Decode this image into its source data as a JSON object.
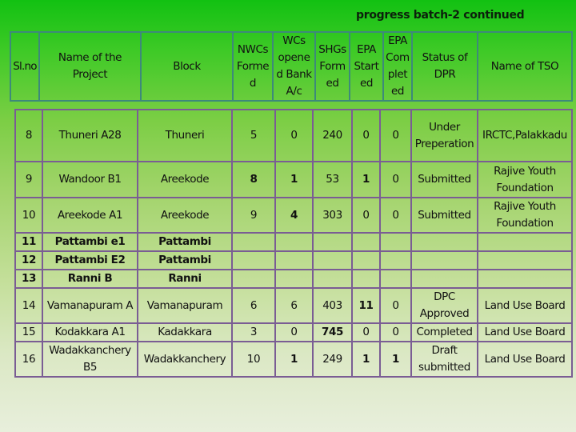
{
  "title": "progress batch-2 continued",
  "columns": [
    "Sl.no",
    "Name of the Project",
    "Block",
    "NWCs Formed",
    "WCs opened Bank A/c",
    "SHGs Formed",
    "EPA Started",
    "EPA Completed",
    "Status of DPR",
    "Name of TSO"
  ],
  "header_display": [
    "Sl.no",
    "Name of the\nProject",
    "Block",
    "NWCs\nForme\nd",
    "WCs\nopene\nd Bank\nA/c",
    "SHGs\nForm\ned",
    "EPA\nStart\ned",
    "EPA\nCom\nplet\ned",
    "Status of\nDPR",
    "Name of TSO"
  ],
  "rows": [
    {
      "slno": "8",
      "project": "Thuneri A28",
      "block": "Thuneri",
      "nwcs": "5",
      "wcs_bank": "0",
      "shgs": "240",
      "epa_started": "0",
      "epa_completed": "0",
      "dpr_status": "Under Preperation",
      "tso": "IRCTC,Palakkadu"
    },
    {
      "slno": "9",
      "project": "Wandoor B1",
      "block": "Areekode",
      "nwcs": "8",
      "wcs_bank": "1",
      "shgs": "53",
      "epa_started": "1",
      "epa_completed": "0",
      "dpr_status": "Submitted",
      "tso": "Rajive Youth Foundation"
    },
    {
      "slno": "10",
      "project": "Areekode A1",
      "block": "Areekode",
      "nwcs": "9",
      "wcs_bank": "4",
      "shgs": "303",
      "epa_started": "0",
      "epa_completed": "0",
      "dpr_status": "Submitted",
      "tso": "Rajive Youth Foundation"
    },
    {
      "slno": "11",
      "project": "Pattambi e1",
      "block": "Pattambi",
      "nwcs": "",
      "wcs_bank": "",
      "shgs": "",
      "epa_started": "",
      "epa_completed": "",
      "dpr_status": "",
      "tso": ""
    },
    {
      "slno": "12",
      "project": "Pattambi E2",
      "block": "Pattambi",
      "nwcs": "",
      "wcs_bank": "",
      "shgs": "",
      "epa_started": "",
      "epa_completed": "",
      "dpr_status": "",
      "tso": ""
    },
    {
      "slno": "13",
      "project": "Ranni B",
      "block": "Ranni",
      "nwcs": "",
      "wcs_bank": "",
      "shgs": "",
      "epa_started": "",
      "epa_completed": "",
      "dpr_status": "",
      "tso": ""
    },
    {
      "slno": "14",
      "project": "Vamanapuram A",
      "block": "Vamanapuram",
      "nwcs": "6",
      "wcs_bank": "6",
      "shgs": "403",
      "epa_started": "11",
      "epa_completed": "0",
      "dpr_status": "DPC Approved",
      "tso": "Land Use Board"
    },
    {
      "slno": "15",
      "project": "Kodakkara A1",
      "block": "Kadakkara",
      "nwcs": "3",
      "wcs_bank": "0",
      "shgs": "745",
      "epa_started": "0",
      "epa_completed": "0",
      "dpr_status": "Completed",
      "tso": "Land Use Board"
    },
    {
      "slno": "16",
      "project": "Wadakkanchery B5",
      "block": "Wadakkanchery",
      "nwcs": "10",
      "wcs_bank": "1",
      "shgs": "249",
      "epa_started": "1",
      "epa_completed": "1",
      "dpr_status": "Draft submitted",
      "tso": "Land Use Board"
    }
  ]
}
